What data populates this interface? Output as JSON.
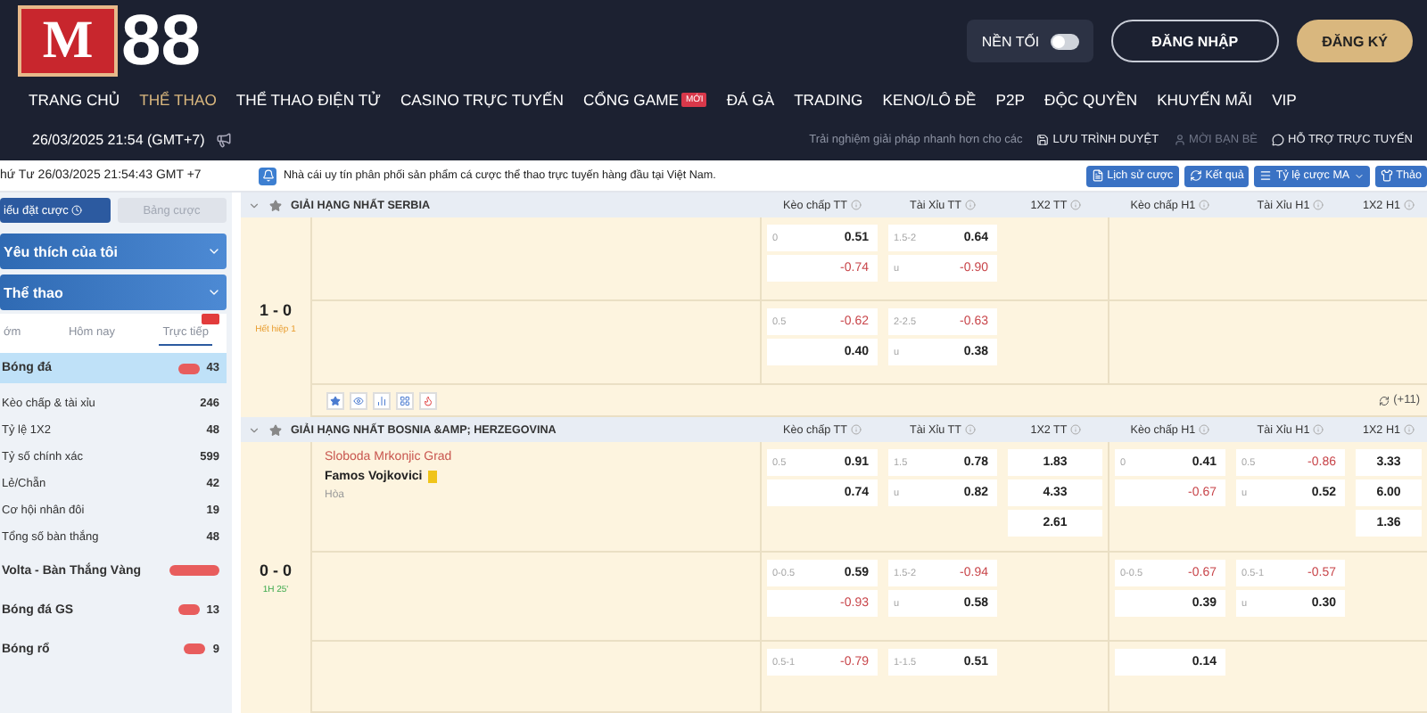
{
  "header": {
    "logo": {
      "mark": "M",
      "digits": "88"
    },
    "toggle": {
      "label": "NỀN TỐI",
      "on": false
    },
    "login": "ĐĂNG NHẬP",
    "register": "ĐĂNG KÝ"
  },
  "nav": [
    {
      "label": "TRANG CHỦ",
      "selected": false
    },
    {
      "label": "THỂ THAO",
      "selected": true
    },
    {
      "label": "THỂ THAO ĐIỆN TỬ",
      "selected": false
    },
    {
      "label": "CASINO TRỰC TUYẾN",
      "selected": false
    },
    {
      "label": "CỔNG GAME",
      "selected": false,
      "badge": "MỚI"
    },
    {
      "label": "ĐÁ GÀ",
      "selected": false
    },
    {
      "label": "TRADING",
      "selected": false
    },
    {
      "label": "KENO/LÔ ĐỀ",
      "selected": false
    },
    {
      "label": "P2P",
      "selected": false
    },
    {
      "label": "ĐỘC QUYỀN",
      "selected": false
    },
    {
      "label": "KHUYẾN MÃI",
      "selected": false
    },
    {
      "label": "VIP",
      "selected": false
    }
  ],
  "info_bar": {
    "datetime": "26/03/2025 21:54 (GMT+7)",
    "promo": "Trải nghiệm giải pháp nhanh hơn cho các",
    "links": [
      {
        "label": "LƯU TRÌNH DUYỆT",
        "disabled": false
      },
      {
        "label": "MỜI BẠN BÈ",
        "disabled": true
      },
      {
        "label": "HỖ TRỢ TRỰC TUYẾN",
        "disabled": false
      }
    ]
  },
  "sub_bar": {
    "clock": "hứ Tư 26/03/2025 21:54:43 GMT +7",
    "notice": "Nhà cái uy tín phân phối sản phẩm cá cược thể thao trực tuyến hàng đầu tại Việt Nam.",
    "buttons": [
      "Lịch sử cược",
      "Kết quả",
      "Tỷ lệ cược MA",
      "Thảo"
    ]
  },
  "sidebar": {
    "tabs": [
      {
        "label": "iếu đặt cược",
        "selected": true
      },
      {
        "label": "Bảng cược",
        "selected": false
      }
    ],
    "sections": [
      "Yêu thích của tôi",
      "Thể thao"
    ],
    "filters": [
      {
        "label": "ớm",
        "selected": false,
        "badge": false
      },
      {
        "label": "Hôm nay",
        "selected": false,
        "badge": false
      },
      {
        "label": "Trực tiếp",
        "selected": true,
        "badge": true
      }
    ],
    "items": [
      {
        "kind": "sport",
        "label": "Bóng đá",
        "live_badge": true,
        "count": "43",
        "selected": true
      },
      {
        "kind": "market",
        "label": "Kèo chấp & tài xỉu",
        "count": "246",
        "selected": false
      },
      {
        "kind": "market",
        "label": "Tỷ lệ 1X2",
        "count": "48",
        "selected": false
      },
      {
        "kind": "market",
        "label": "Tỷ số chính xác",
        "count": "599",
        "selected": false
      },
      {
        "kind": "market",
        "label": "Lẻ/Chẵn",
        "count": "42",
        "selected": false
      },
      {
        "kind": "market",
        "label": "Cơ hội nhân đôi",
        "count": "19",
        "selected": false
      },
      {
        "kind": "market",
        "label": "Tổng số bàn thắng",
        "count": "48",
        "selected": false
      },
      {
        "kind": "sport",
        "label": "Volta - Bàn Thắng Vàng",
        "hot_badge": true,
        "selected": false
      },
      {
        "kind": "sport",
        "label": "Bóng đá GS",
        "live_badge": true,
        "count": "13",
        "selected": false
      },
      {
        "kind": "sport",
        "label": "Bóng rổ",
        "live_badge": true,
        "count": "9",
        "selected": false
      }
    ]
  },
  "table": {
    "leagues": [
      {
        "name": "GIẢI HẠNG NHẤT SERBIA",
        "columns": [
          "Kèo chấp TT",
          "Tài Xỉu TT",
          "1X2 TT",
          "Kèo chấp H1",
          "Tài Xỉu H1",
          "1X2 H1"
        ],
        "match": {
          "score": "1 - 0",
          "status": "Hết hiệp 1",
          "live": false,
          "extra": "(+11)",
          "rows": [
            {
              "cells": [
                {
                  "kind": "pair",
                  "items": [
                    {
                      "line": "0",
                      "odds": "0.51",
                      "negative": false
                    },
                    {
                      "odds": "-0.74",
                      "negative": true
                    }
                  ]
                },
                {
                  "kind": "pair",
                  "items": [
                    {
                      "line": "1.5-2",
                      "odds": "0.64",
                      "negative": false
                    },
                    {
                      "line": "u",
                      "odds": "-0.90",
                      "negative": true
                    }
                  ]
                },
                {
                  "kind": "empty"
                },
                {
                  "kind": "empty"
                },
                {
                  "kind": "empty"
                },
                {
                  "kind": "empty"
                }
              ]
            },
            {
              "cells": [
                {
                  "kind": "pair",
                  "items": [
                    {
                      "line": "0.5",
                      "odds": "-0.62",
                      "negative": true
                    },
                    {
                      "odds": "0.40",
                      "negative": false
                    }
                  ]
                },
                {
                  "kind": "pair",
                  "items": [
                    {
                      "line": "2-2.5",
                      "odds": "-0.63",
                      "negative": true
                    },
                    {
                      "line": "u",
                      "odds": "0.38",
                      "negative": false
                    }
                  ]
                },
                {
                  "kind": "empty"
                },
                {
                  "kind": "empty"
                },
                {
                  "kind": "empty"
                },
                {
                  "kind": "empty"
                }
              ]
            }
          ]
        }
      },
      {
        "name": "GIẢI HẠNG NHẤT BOSNIA &AMP; HERZEGOVINA",
        "columns": [
          "Kèo chấp TT",
          "Tài Xỉu TT",
          "1X2 TT",
          "Kèo chấp H1",
          "Tài Xỉu H1",
          "1X2 H1"
        ],
        "match": {
          "score": "0 - 0",
          "status": "1H 25'",
          "live": true,
          "teams": [
            {
              "name": "Sloboda Mrkonjic Grad",
              "kind": "home",
              "yellow_card": false
            },
            {
              "name": "Famos Vojkovici",
              "kind": "away",
              "yellow_card": true
            }
          ],
          "draw": "Hòa",
          "rows": [
            {
              "cells": [
                {
                  "kind": "pair",
                  "items": [
                    {
                      "line": "0.5",
                      "odds": "0.91",
                      "negative": false
                    },
                    {
                      "odds": "0.74",
                      "negative": false
                    }
                  ]
                },
                {
                  "kind": "pair",
                  "items": [
                    {
                      "line": "1.5",
                      "odds": "0.78",
                      "negative": false
                    },
                    {
                      "line": "u",
                      "odds": "0.82",
                      "negative": false
                    }
                  ]
                },
                {
                  "kind": "list",
                  "items": [
                    "1.83",
                    "4.33",
                    "2.61"
                  ]
                },
                {
                  "kind": "pair",
                  "items": [
                    {
                      "line": "0",
                      "odds": "0.41",
                      "negative": false
                    },
                    {
                      "odds": "-0.67",
                      "negative": true
                    }
                  ]
                },
                {
                  "kind": "pair",
                  "items": [
                    {
                      "line": "0.5",
                      "odds": "-0.86",
                      "negative": true
                    },
                    {
                      "line": "u",
                      "odds": "0.52",
                      "negative": false
                    }
                  ]
                },
                {
                  "kind": "list",
                  "items": [
                    "3.33",
                    "6.00",
                    "1.36"
                  ]
                }
              ]
            },
            {
              "cells": [
                {
                  "kind": "pair",
                  "items": [
                    {
                      "line": "0-0.5",
                      "odds": "0.59",
                      "negative": false
                    },
                    {
                      "odds": "-0.93",
                      "negative": true
                    }
                  ]
                },
                {
                  "kind": "pair",
                  "items": [
                    {
                      "line": "1.5-2",
                      "odds": "-0.94",
                      "negative": true
                    },
                    {
                      "line": "u",
                      "odds": "0.58",
                      "negative": false
                    }
                  ]
                },
                {
                  "kind": "empty"
                },
                {
                  "kind": "pair",
                  "items": [
                    {
                      "line": "0-0.5",
                      "odds": "-0.67",
                      "negative": true
                    },
                    {
                      "odds": "0.39",
                      "negative": false
                    }
                  ]
                },
                {
                  "kind": "pair",
                  "items": [
                    {
                      "line": "0.5-1",
                      "odds": "-0.57",
                      "negative": true
                    },
                    {
                      "line": "u",
                      "odds": "0.30",
                      "negative": false
                    }
                  ]
                },
                {
                  "kind": "empty"
                }
              ]
            },
            {
              "cells": [
                {
                  "kind": "pair",
                  "items": [
                    {
                      "line": "0.5-1",
                      "odds": "-0.79",
                      "negative": true
                    }
                  ]
                },
                {
                  "kind": "pair",
                  "items": [
                    {
                      "line": "1-1.5",
                      "odds": "0.51",
                      "negative": false
                    }
                  ]
                },
                {
                  "kind": "empty"
                },
                {
                  "kind": "pair",
                  "items": [
                    {
                      "odds": "0.14",
                      "negative": false
                    }
                  ]
                },
                {
                  "kind": "empty"
                },
                {
                  "kind": "empty"
                }
              ]
            }
          ]
        }
      }
    ]
  }
}
